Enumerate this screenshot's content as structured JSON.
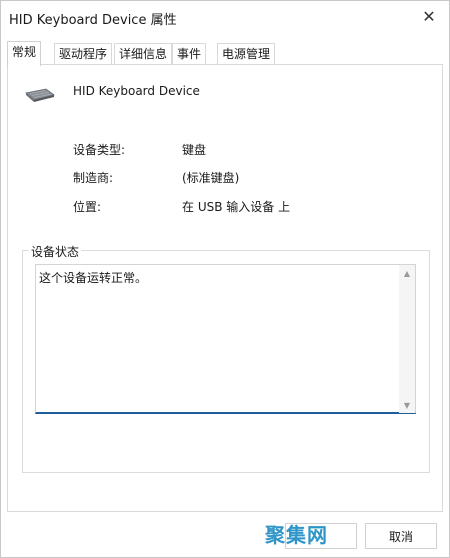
{
  "window": {
    "title": "HID Keyboard Device 属性",
    "close_glyph": "✕"
  },
  "tabs": [
    {
      "label": "常规",
      "active": true
    },
    {
      "label": "驱动程序",
      "active": false
    },
    {
      "label": "详细信息",
      "active": false
    },
    {
      "label": "事件",
      "active": false
    },
    {
      "label": "电源管理",
      "active": false
    }
  ],
  "general": {
    "device_name": "HID Keyboard Device",
    "device_icon": "keyboard-icon",
    "properties": [
      {
        "label": "设备类型:",
        "value": "键盘"
      },
      {
        "label": "制造商:",
        "value": "(标准键盘)"
      },
      {
        "label": "位置:",
        "value": "在 USB 输入设备 上"
      }
    ]
  },
  "status": {
    "legend": "设备状态",
    "text": "这个设备运转正常。"
  },
  "buttons": {
    "cancel": "取消"
  },
  "watermark": {
    "text": "聚集网"
  },
  "colors": {
    "focus_underline": "#1f5f99",
    "border": "#d9d9d9"
  }
}
